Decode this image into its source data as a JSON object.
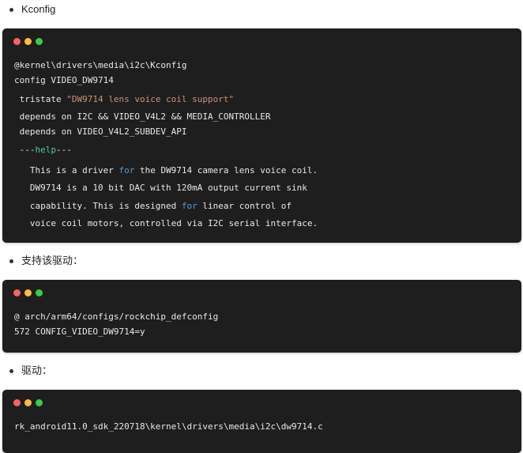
{
  "sections": [
    {
      "bullet": "Kconfig"
    },
    {
      "bullet": "支持该驱动："
    },
    {
      "bullet": "驱动："
    }
  ],
  "block1": {
    "path": "@kernel\\drivers\\media\\i2c\\Kconfig",
    "config": "config VIDEO_DW9714",
    "tristate_kw": " tristate ",
    "tristate_str": "\"DW9714 lens voice coil support\"",
    "depends1": " depends on I2C && VIDEO_V4L2 && MEDIA_CONTROLLER",
    "depends2": " depends on VIDEO_V4L2_SUBDEV_API",
    "help_pre": " ---",
    "help_kw": "help",
    "help_post": "---",
    "desc1_a": "   This is a driver ",
    "desc1_for": "for",
    "desc1_b": " the DW9714 camera lens voice coil.",
    "desc2": "   DW9714 is a 10 bit DAC with 120mA output current sink",
    "desc3_a": "   capability. This is designed ",
    "desc3_for": "for",
    "desc3_b": " linear control of",
    "desc4": "   voice coil motors, controlled via I2C serial interface."
  },
  "block2": {
    "path": "@ arch/arm64/configs/rockchip_defconfig",
    "line": "572 CONFIG_VIDEO_DW9714=y"
  },
  "block3": {
    "path": "rk_android11.0_sdk_220718\\kernel\\drivers\\media\\i2c\\dw9714.c"
  }
}
